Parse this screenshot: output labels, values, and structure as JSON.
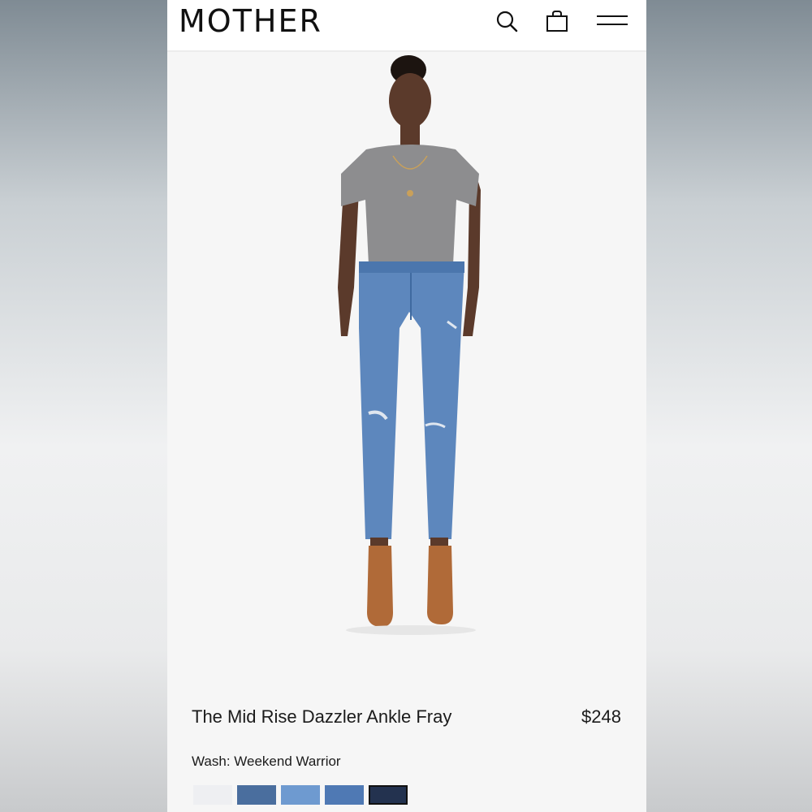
{
  "brand": {
    "logo_text": "MOTHER"
  },
  "header": {
    "icons": [
      "search-icon",
      "shopping-bag-icon",
      "menu-icon"
    ]
  },
  "product": {
    "title": "The Mid Rise Dazzler Ankle Fray",
    "price": "$248",
    "wash_label": "Wash: Weekend Warrior",
    "swatches": [
      {
        "name": "white-wash",
        "color": "#eeeff2"
      },
      {
        "name": "dark-blue-wash",
        "color": "#4a6e9e"
      },
      {
        "name": "light-blue-wash",
        "color": "#6e9ad0"
      },
      {
        "name": "medium-blue-wash",
        "color": "#4f79b4"
      },
      {
        "name": "indigo-wash",
        "color": "#23324f",
        "selected": true
      }
    ]
  },
  "colors": {
    "page_background": "#f6f6f6",
    "header_background": "#ffffff",
    "text": "#1b1b1b",
    "tee": "#8d8d8f",
    "denim": "#5d87bd",
    "boots": "#b06a38",
    "skin": "#5b3a2b"
  }
}
